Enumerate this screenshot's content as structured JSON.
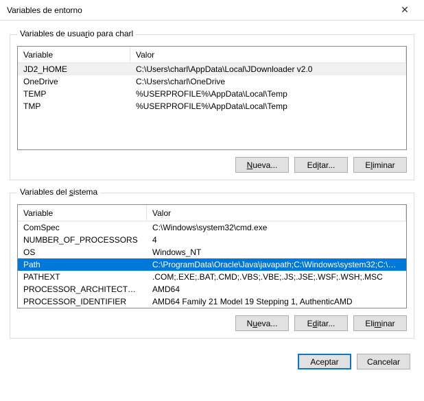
{
  "window": {
    "title": "Variables de entorno"
  },
  "userGroup": {
    "legend_prefix": "Variables de usua",
    "legend_ul": "r",
    "legend_suffix": "io para charl",
    "col_variable": "Variable",
    "col_valor": "Valor",
    "rows": [
      {
        "name": "JD2_HOME",
        "value": "C:\\Users\\charl\\AppData\\Local\\JDownloader v2.0"
      },
      {
        "name": "OneDrive",
        "value": "C:\\Users\\charl\\OneDrive"
      },
      {
        "name": "TEMP",
        "value": "%USERPROFILE%\\AppData\\Local\\Temp"
      },
      {
        "name": "TMP",
        "value": "%USERPROFILE%\\AppData\\Local\\Temp"
      }
    ],
    "buttons": {
      "new": "Nueva...",
      "edit": "Editar...",
      "delete": "Eliminar"
    },
    "selected_index": 0
  },
  "sysGroup": {
    "legend": "Variables del sistema",
    "col_variable": "Variable",
    "col_valor": "Valor",
    "rows": [
      {
        "name": "ComSpec",
        "value": "C:\\Windows\\system32\\cmd.exe"
      },
      {
        "name": "NUMBER_OF_PROCESSORS",
        "value": "4"
      },
      {
        "name": "OS",
        "value": "Windows_NT"
      },
      {
        "name": "Path",
        "value": "C:\\ProgramData\\Oracle\\Java\\javapath;C:\\Windows\\system32;C:\\Wi..."
      },
      {
        "name": "PATHEXT",
        "value": ".COM;.EXE;.BAT;.CMD;.VBS;.VBE;.JS;.JSE;.WSF;.WSH;.MSC"
      },
      {
        "name": "PROCESSOR_ARCHITECTURE",
        "value": "AMD64"
      },
      {
        "name": "PROCESSOR_IDENTIFIER",
        "value": "AMD64 Family 21 Model 19 Stepping 1, AuthenticAMD"
      }
    ],
    "buttons": {
      "new": "Nueva...",
      "edit": "Editar...",
      "delete": "Eliminar"
    },
    "selected_index": 3
  },
  "dialog": {
    "ok": "Aceptar",
    "cancel": "Cancelar"
  }
}
